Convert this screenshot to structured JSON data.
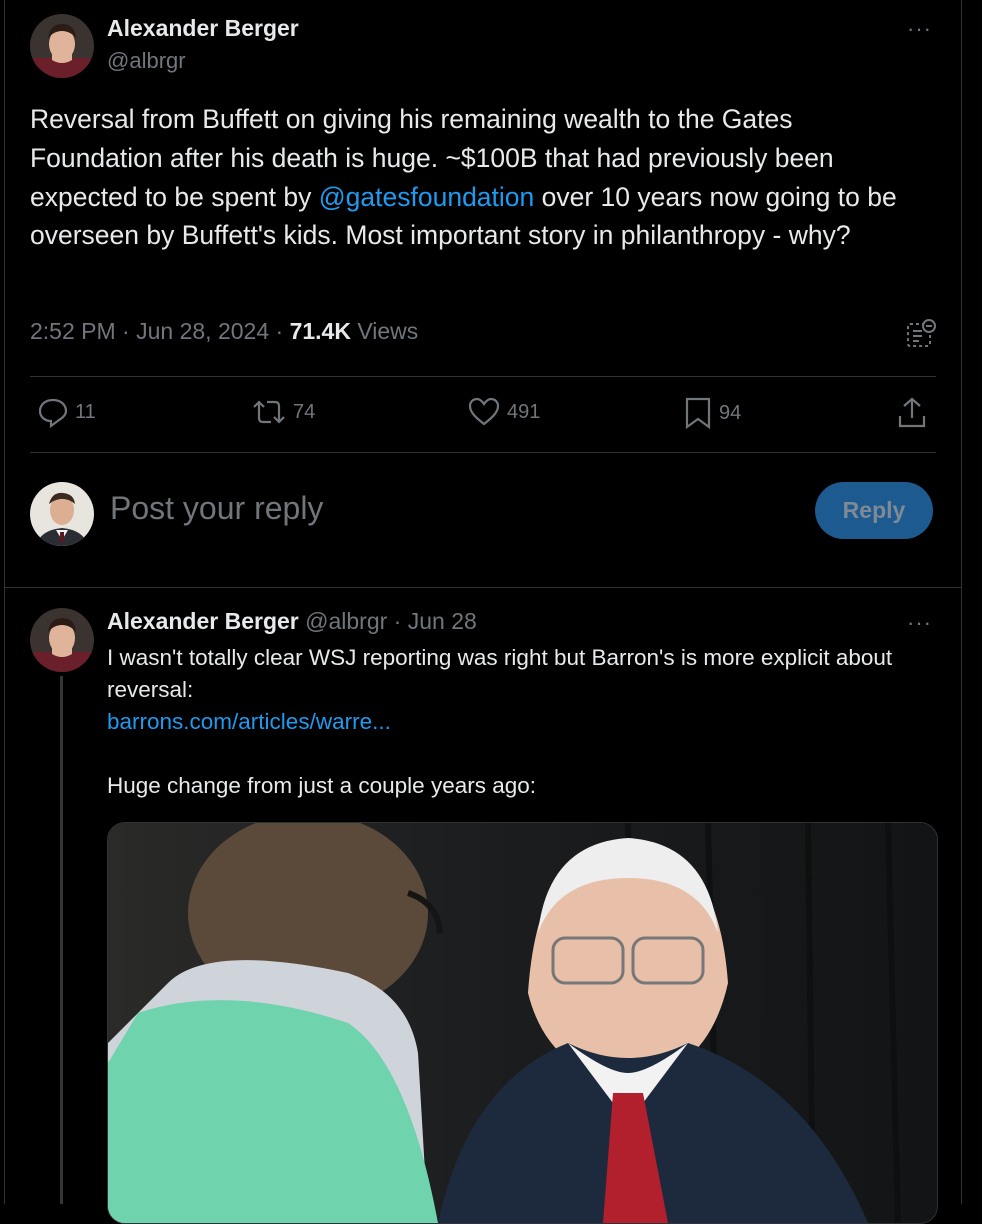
{
  "tweet": {
    "author_name": "Alexander Berger",
    "author_handle": "@albrgr",
    "more_label": "···",
    "text_before_mention": "Reversal from Buffett on giving his remaining wealth to the Gates Foundation after his death is huge. ~$100B that had previously been expected to be spent by ",
    "mention": "@gatesfoundation",
    "text_after_mention": " over 10 years now going to be overseen by Buffett's kids. Most important story in philanthropy - why?",
    "time": "2:52 PM",
    "date": "Jun 28, 2024",
    "views_count": "71.4K",
    "views_label": "Views",
    "separator": " · "
  },
  "actions": {
    "replies": "11",
    "reposts": "74",
    "likes": "491",
    "bookmarks": "94"
  },
  "composer": {
    "placeholder": "Post your reply",
    "button_label": "Reply"
  },
  "reply": {
    "author_name": "Alexander Berger",
    "author_handle": "@albrgr",
    "date": "Jun 28",
    "more_label": "···",
    "line1": "I wasn't totally clear WSJ reporting was right but Barron's is more explicit about reversal:",
    "link": "barrons.com/articles/warre...",
    "line2": "Huge change from just a couple years ago:"
  },
  "colors": {
    "background": "#000000",
    "accent": "#1d9bf0",
    "muted": "#71767b",
    "text": "#e7e9ea"
  }
}
